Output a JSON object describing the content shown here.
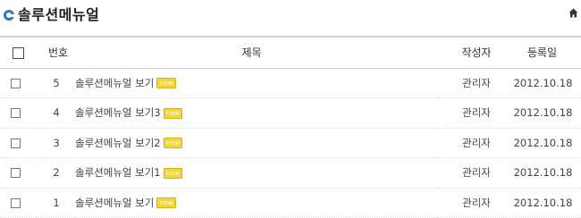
{
  "header": {
    "title": "솔루션메뉴얼",
    "title_icon": "ring-bullet-icon",
    "home_icon": "home-icon",
    "accent_color": "#2a78c2"
  },
  "table": {
    "columns": {
      "number": "번호",
      "title": "제목",
      "author": "작성자",
      "date": "등록일"
    },
    "rows": [
      {
        "number": "5",
        "title": "솔루션메뉴얼 보기",
        "badge": "new",
        "author": "관리자",
        "date": "2012.10.18"
      },
      {
        "number": "4",
        "title": "솔루션메뉴얼 보기3",
        "badge": "new",
        "author": "관리자",
        "date": "2012.10.18"
      },
      {
        "number": "3",
        "title": "솔루션메뉴얼 보기2",
        "badge": "new",
        "author": "관리자",
        "date": "2012.10.18"
      },
      {
        "number": "2",
        "title": "솔루션메뉴얼 보기1",
        "badge": "new",
        "author": "관리자",
        "date": "2012.10.18"
      },
      {
        "number": "1",
        "title": "솔루션메뉴얼 보기",
        "badge": "new",
        "author": "관리자",
        "date": "2012.10.18"
      }
    ],
    "badge_color": "#f3d63b"
  }
}
